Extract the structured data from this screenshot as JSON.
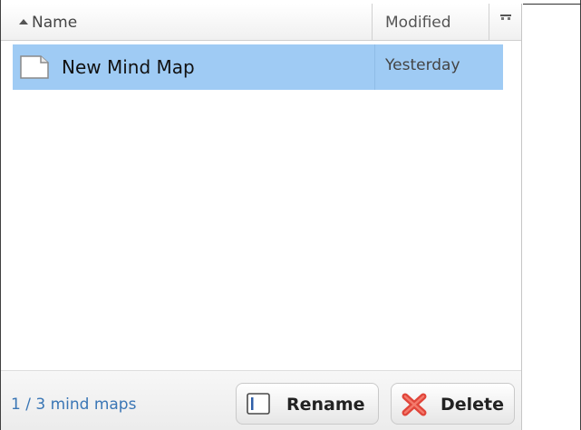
{
  "header": {
    "name_label": "Name",
    "modified_label": "Modified",
    "sort_direction": "ascending"
  },
  "rows": [
    {
      "name": "New Mind Map",
      "modified": "Yesterday",
      "selected": true
    }
  ],
  "footer": {
    "count_label": "1 / 3 mind maps",
    "rename_label": "Rename",
    "delete_label": "Delete"
  },
  "icons": {
    "sort": "sort-ascending-icon",
    "column_picker": "column-picker-icon",
    "file": "file-icon",
    "rename": "rename-icon",
    "delete": "delete-icon"
  },
  "colors": {
    "selection": "#9fcbf4",
    "count_text": "#3a76b5",
    "delete_icon": "#e0453a"
  }
}
